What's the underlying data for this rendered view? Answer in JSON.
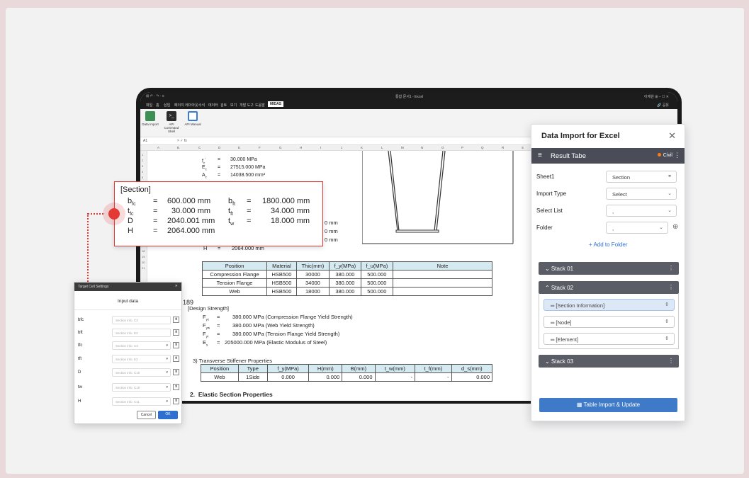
{
  "excel": {
    "title_left": "⊞ ↶ · ↷ · ≡",
    "title_center": "통합 문서1 - Excel",
    "title_right": "이재원  ⊞   –   ☐   ✕",
    "menu": [
      "파일",
      "홈",
      "삽입",
      "페이지 레이아웃",
      "수식",
      "데이터",
      "검토",
      "보기",
      "개발 도구",
      "도움말",
      "MIDAS"
    ],
    "share": "🔗 공유",
    "ribbon": [
      {
        "label": "Data Import",
        "icon": "data-import-icon"
      },
      {
        "label": "API Command Shell",
        "icon": "terminal-icon"
      },
      {
        "label": "API Manual",
        "icon": "manual-book-icon"
      }
    ],
    "cell_ref": "A1",
    "formula_symbols": "×  ✓  fx",
    "columns": [
      "A",
      "B",
      "C",
      "D",
      "E",
      "F",
      "G",
      "H",
      "I",
      "J",
      "K",
      "L",
      "M",
      "N",
      "O",
      "P",
      "Q",
      "R",
      "S"
    ],
    "rows": [
      "1",
      "2",
      "3",
      "4",
      "5",
      "6",
      "7",
      "8",
      "9",
      "10",
      "11",
      "12",
      "13",
      "14",
      "15",
      "16",
      "17",
      "18",
      "19",
      "20",
      "21"
    ]
  },
  "sheet": {
    "props": [
      {
        "sym": "f",
        "sub": "c",
        "sup": "'",
        "eq": "=",
        "val": "30.000 MPa"
      },
      {
        "sym": "E",
        "sub": "c",
        "sup": "",
        "eq": "=",
        "val": "27515.000 MPa"
      },
      {
        "sym": "A",
        "sub": "c",
        "sup": "",
        "eq": "=",
        "val": "14038.500 mm²"
      }
    ],
    "partial_mm": [
      "0 mm",
      "0 mm",
      "0 mm"
    ],
    "h_row": {
      "sym": "H",
      "eq": "=",
      "val": "2064.000 mm"
    },
    "material_table": {
      "headers": [
        "Position",
        "Material",
        "Thic(mm)",
        "f_y(MPa)",
        "f_u(MPa)",
        "Note"
      ],
      "rows": [
        [
          "Compression Flange",
          "HSB500",
          "30000",
          "380.000",
          "500.000",
          ""
        ],
        [
          "Tension Flange",
          "HSB500",
          "34000",
          "380.000",
          "500.000",
          ""
        ],
        [
          "Web",
          "HSB500",
          "18000",
          "380.000",
          "500.000",
          ""
        ]
      ]
    },
    "row_189": "189",
    "design_strength": {
      "title": "[Design Strength]",
      "items": [
        {
          "sym": "F",
          "sub": "yc",
          "eq": "=",
          "val": "380.000 MPa (Compression Flange Yield Strength)"
        },
        {
          "sym": "F",
          "sub": "yw",
          "eq": "=",
          "val": "380.000 MPa (Web Yield Strength)"
        },
        {
          "sym": "F",
          "sub": "yt",
          "eq": "=",
          "val": "380.000 MPa (Tension Flange Yield Strength)"
        },
        {
          "sym": "E",
          "sub": "s",
          "eq": "=",
          "val": "205000.000 MPa (Elastic Modulus of Steel)"
        }
      ]
    },
    "stiffener": {
      "title": "3)  Transverse Stiffener Properties",
      "headers": [
        "Position",
        "Type",
        "f_y(MPa)",
        "H(mm)",
        "B(mm)",
        "t_w(mm)",
        "t_f(mm)",
        "d_s(mm)"
      ],
      "row": [
        "Web",
        "1Side",
        "0.000",
        "0.000",
        "0.000",
        "-",
        "-",
        "0.000"
      ]
    },
    "elastic": {
      "num": "2.",
      "title": "Elastic Section Properties"
    }
  },
  "callout": {
    "title": "[Section]",
    "rows": [
      [
        {
          "sym": "b",
          "sub": "fc",
          "eq": "=",
          "val": "600.000 mm"
        },
        {
          "sym": "b",
          "sub": "ft",
          "eq": "=",
          "val": "1800.000 mm"
        }
      ],
      [
        {
          "sym": "t",
          "sub": "fc",
          "eq": "=",
          "val": "30.000 mm"
        },
        {
          "sym": "t",
          "sub": "ft",
          "eq": "=",
          "val": "34.000 mm"
        }
      ],
      [
        {
          "sym": "D",
          "sub": "",
          "eq": "=",
          "val": "2040.001 mm"
        },
        {
          "sym": "t",
          "sub": "w",
          "eq": "=",
          "val": "18.000 mm"
        }
      ],
      [
        {
          "sym": "H",
          "sub": "",
          "eq": "=",
          "val": "2064.000 mm"
        }
      ]
    ]
  },
  "dialog": {
    "title": "Target Cell Settings",
    "close": "✕",
    "header": "Input data",
    "fields": [
      {
        "label": "bfc",
        "value": "Section info. C3",
        "dropdown": false
      },
      {
        "label": "bft",
        "value": "Section info. E3",
        "dropdown": false
      },
      {
        "label": "tfc",
        "value": "Section info. C3",
        "dropdown": true
      },
      {
        "label": "tft",
        "value": "Section info. E3",
        "dropdown": true
      },
      {
        "label": "D",
        "value": "Section info. C10",
        "dropdown": true
      },
      {
        "label": "tw",
        "value": "Section info. C10",
        "dropdown": true
      },
      {
        "label": "H",
        "value": "Section info. C11",
        "dropdown": true
      }
    ],
    "cancel": "Cancel",
    "ok": "OK"
  },
  "panel": {
    "title": "Data Import for Excel",
    "close": "✕",
    "menu_icon": "≡",
    "bar_title": "Result Tabe",
    "badge": "Civil",
    "kebab": "⋮",
    "fields": [
      {
        "label": "Sheet1",
        "value": "Section",
        "icon": "⚭"
      },
      {
        "label": "Import Type",
        "value": "Select",
        "icon": "⌄"
      },
      {
        "label": "Select List",
        "value": ",",
        "icon": "⌄"
      },
      {
        "label": "Folder",
        "value": ",",
        "icon": "⌄"
      }
    ],
    "folder_add": "⊕",
    "add_folder": "+  Add to Folder",
    "stacks": [
      {
        "label": "⌄   Stack 01"
      },
      {
        "label": "⌃   Stack 02"
      },
      {
        "label": "⌄   Stack 03"
      }
    ],
    "stack_items": [
      {
        "label": "═  [Section Information]",
        "selected": true
      },
      {
        "label": "═  [Node]",
        "selected": false
      },
      {
        "label": "═  [Element]",
        "selected": false
      }
    ],
    "updown": "⇕",
    "import_button": "▦ Table Import & Update"
  }
}
